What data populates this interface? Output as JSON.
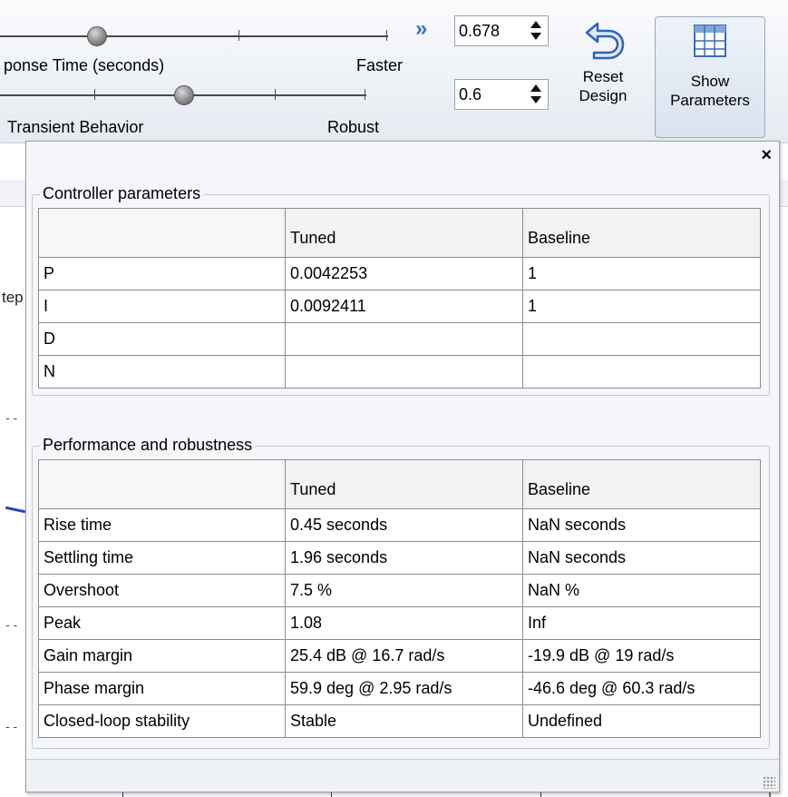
{
  "toolbar": {
    "response_time_label": "ponse Time (seconds)",
    "faster_label": "Faster",
    "transient_label": "Transient Behavior",
    "robust_label": "Robust",
    "response_time_value": "0.678",
    "transient_value": "0.6",
    "reset_line1": "Reset",
    "reset_line2": "Design",
    "show_line1": "Show",
    "show_line2": "Parameters",
    "close_glyph": "×",
    "expand_glyph": "»",
    "accent_color": "#3b6fc4"
  },
  "background": {
    "fragment": "tep"
  },
  "panel": {
    "controller": {
      "title": "Controller parameters",
      "columns": [
        "",
        "Tuned",
        "Baseline"
      ],
      "rows": [
        [
          "P",
          "0.0042253",
          "1"
        ],
        [
          "I",
          "0.0092411",
          "1"
        ],
        [
          "D",
          "",
          ""
        ],
        [
          "N",
          "",
          ""
        ]
      ]
    },
    "performance": {
      "title": "Performance and robustness",
      "columns": [
        "",
        "Tuned",
        "Baseline"
      ],
      "rows": [
        [
          "Rise time",
          "0.45 seconds",
          "NaN seconds"
        ],
        [
          "Settling time",
          "1.96 seconds",
          "NaN seconds"
        ],
        [
          "Overshoot",
          "7.5 %",
          "NaN %"
        ],
        [
          "Peak",
          "1.08",
          "Inf"
        ],
        [
          "Gain margin",
          "25.4 dB @ 16.7 rad/s",
          "-19.9 dB @ 19 rad/s"
        ],
        [
          "Phase margin",
          "59.9 deg @ 2.95 rad/s",
          "-46.6 deg @ 60.3 rad/s"
        ],
        [
          "Closed-loop stability",
          "Stable",
          "Undefined"
        ]
      ]
    }
  }
}
